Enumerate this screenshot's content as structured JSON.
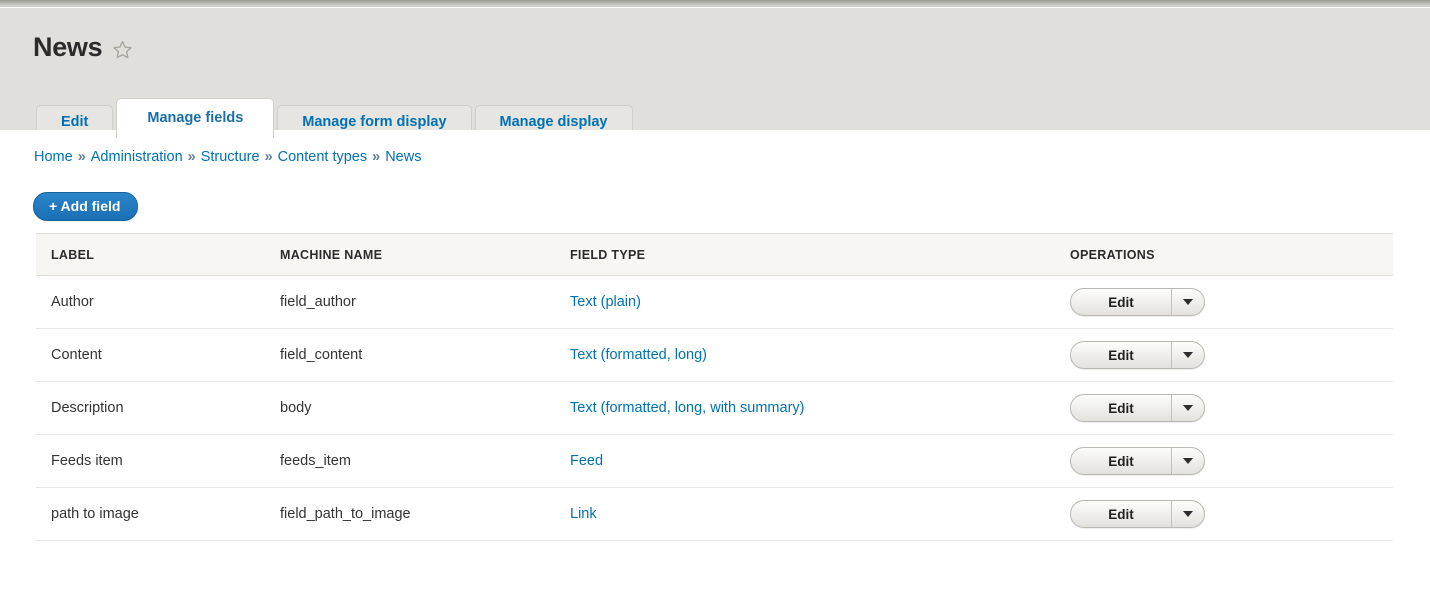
{
  "page": {
    "title": "News",
    "star_icon": "star-outline-icon"
  },
  "tabs": [
    {
      "label": "Edit",
      "active": false
    },
    {
      "label": "Manage fields",
      "active": true
    },
    {
      "label": "Manage form display",
      "active": false
    },
    {
      "label": "Manage display",
      "active": false
    }
  ],
  "breadcrumb": {
    "separator": "»",
    "items": [
      "Home",
      "Administration",
      "Structure",
      "Content types",
      "News"
    ]
  },
  "actions": {
    "add_field_label": "+ Add field"
  },
  "table": {
    "columns": [
      "LABEL",
      "MACHINE NAME",
      "FIELD TYPE",
      "OPERATIONS"
    ],
    "rows": [
      {
        "label": "Author",
        "machine_name": "field_author",
        "field_type": "Text (plain)",
        "operation": "Edit",
        "toggle_icon": "chevron-down-icon"
      },
      {
        "label": "Content",
        "machine_name": "field_content",
        "field_type": "Text (formatted, long)",
        "operation": "Edit",
        "toggle_icon": "chevron-down-icon"
      },
      {
        "label": "Description",
        "machine_name": "body",
        "field_type": "Text (formatted, long, with summary)",
        "operation": "Edit",
        "toggle_icon": "chevron-down-icon"
      },
      {
        "label": "Feeds item",
        "machine_name": "feeds_item",
        "field_type": "Feed",
        "operation": "Edit",
        "toggle_icon": "chevron-down-icon"
      },
      {
        "label": "path to image",
        "machine_name": "field_path_to_image",
        "field_type": "Link",
        "operation": "Edit",
        "toggle_icon": "chevron-down-icon"
      }
    ]
  },
  "colors": {
    "link_blue": "#0071b3",
    "button_blue": "#1f78c1",
    "header_background": "#e0dfdb",
    "table_header_background": "#f7f6f3",
    "text": "#333333"
  }
}
